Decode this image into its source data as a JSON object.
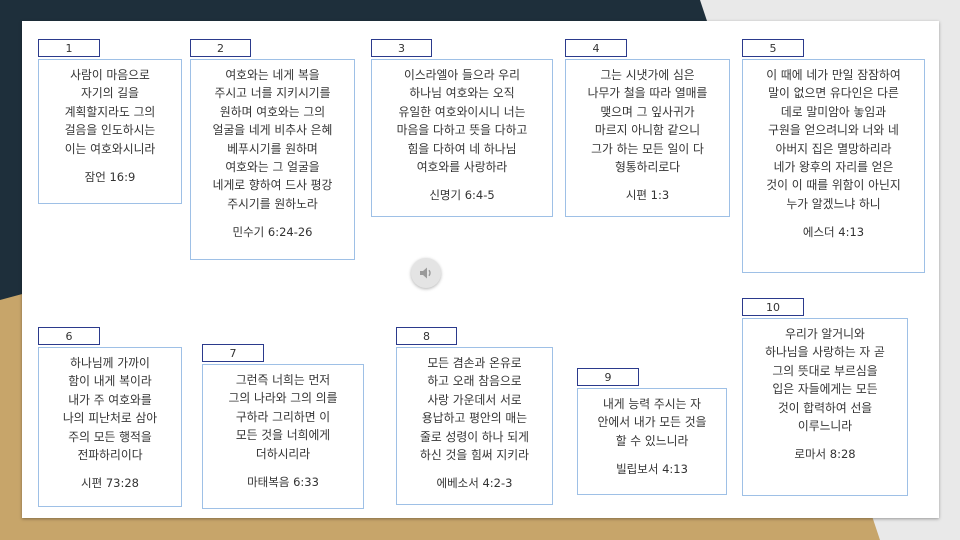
{
  "colors": {
    "background_dark": "#1e2f3b",
    "background_gold": "#c7a56a",
    "number_border": "#2b3a8c",
    "card_border": "#9ec0e6"
  },
  "audio": {
    "icon": "speaker-icon"
  },
  "cards": [
    {
      "number": "1",
      "verse": "사람이 마음으로\n자기의 길을\n계획할지라도 그의\n걸음을 인도하시는\n이는 여호와시니라",
      "ref": "잠언 16:9"
    },
    {
      "number": "2",
      "verse": "여호와는 네게 복을\n주시고 너를 지키시기를\n원하며 여호와는 그의\n얼굴을 네게 비추사 은혜\n베푸시기를 원하며\n여호와는 그 얼굴을\n네게로 향하여 드사 평강\n주시기를 원하노라",
      "ref": "민수기 6:24-26"
    },
    {
      "number": "3",
      "verse": "이스라엘아 들으라 우리\n하나님 여호와는 오직\n유일한 여호와이시니 너는\n마음을 다하고 뜻을 다하고\n힘을 다하여 네 하나님\n여호와를 사랑하라",
      "ref": "신명기 6:4-5"
    },
    {
      "number": "4",
      "verse": "그는 시냇가에 심은\n나무가 철을 따라 열매를\n맺으며 그 잎사귀가\n마르지 아니함 같으니\n그가 하는 모든 일이 다\n형통하리로다",
      "ref": "시편 1:3"
    },
    {
      "number": "5",
      "verse": "이 때에 네가 만일 잠잠하여\n말이 없으면 유다인은 다른\n데로 말미암아 놓임과\n구원을 얻으려니와 너와 네\n아버지 집은 멸망하리라\n네가 왕후의 자리를 얻은\n것이 이 때를 위함이 아닌지\n누가 알겠느냐 하니",
      "ref": "에스더 4:13"
    },
    {
      "number": "6",
      "verse": "하나님께 가까이\n함이 내게 복이라\n내가 주 여호와를\n나의 피난처로 삼아\n주의 모든 행적을\n전파하리이다",
      "ref": "시편 73:28"
    },
    {
      "number": "7",
      "verse": "그런즉 너희는 먼저\n그의 나라와 그의 의를\n구하라 그리하면 이\n모든 것을 너희에게\n더하시리라",
      "ref": "마태복음 6:33"
    },
    {
      "number": "8",
      "verse": "모든 겸손과 온유로\n하고 오래 참음으로\n사랑 가운데서 서로\n용납하고 평안의 매는\n줄로 성령이 하나 되게\n하신 것을 힘써 지키라",
      "ref": "에베소서 4:2-3"
    },
    {
      "number": "9",
      "verse": "내게 능력 주시는 자\n안에서 내가 모든 것을\n할 수 있느니라",
      "ref": "빌립보서 4:13"
    },
    {
      "number": "10",
      "verse": "우리가 알거니와\n하나님을 사랑하는 자 곧\n그의 뜻대로 부르심을\n입은 자들에게는 모든\n것이 합력하여 선을\n이루느니라",
      "ref": "로마서 8:28"
    }
  ]
}
